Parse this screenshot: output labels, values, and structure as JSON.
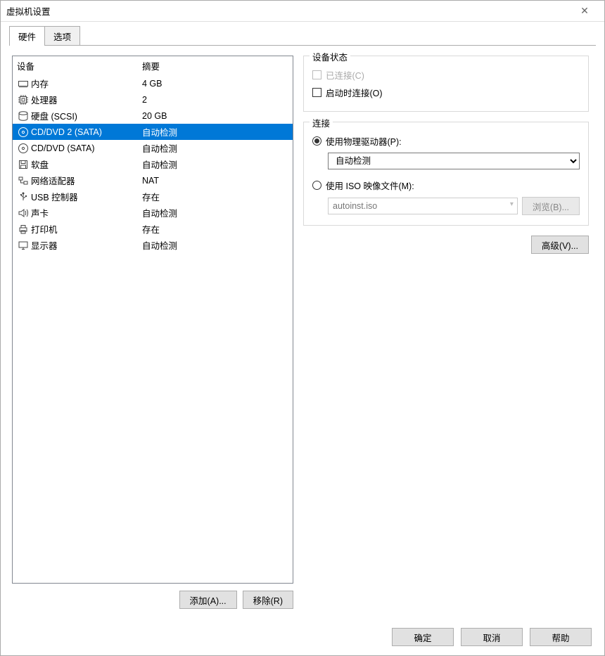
{
  "window": {
    "title": "虚拟机设置"
  },
  "tabs": {
    "hardware": "硬件",
    "options": "选项"
  },
  "columns": {
    "device": "设备",
    "summary": "摘要"
  },
  "devices": [
    {
      "icon": "memory-icon",
      "name": "内存",
      "summary": "4 GB"
    },
    {
      "icon": "cpu-icon",
      "name": "处理器",
      "summary": "2"
    },
    {
      "icon": "disk-icon",
      "name": "硬盘 (SCSI)",
      "summary": "20 GB"
    },
    {
      "icon": "cd-icon",
      "name": "CD/DVD 2 (SATA)",
      "summary": "自动检测",
      "selected": true
    },
    {
      "icon": "cd-icon",
      "name": "CD/DVD (SATA)",
      "summary": "自动检测"
    },
    {
      "icon": "floppy-icon",
      "name": "软盘",
      "summary": "自动检测"
    },
    {
      "icon": "network-icon",
      "name": "网络适配器",
      "summary": "NAT"
    },
    {
      "icon": "usb-icon",
      "name": "USB 控制器",
      "summary": "存在"
    },
    {
      "icon": "sound-icon",
      "name": "声卡",
      "summary": "自动检测"
    },
    {
      "icon": "printer-icon",
      "name": "打印机",
      "summary": "存在"
    },
    {
      "icon": "display-icon",
      "name": "显示器",
      "summary": "自动检测"
    }
  ],
  "buttons": {
    "add": "添加(A)...",
    "remove": "移除(R)",
    "advanced": "高级(V)...",
    "browse": "浏览(B)...",
    "ok": "确定",
    "cancel": "取消",
    "help": "帮助"
  },
  "device_status": {
    "legend": "设备状态",
    "connected": "已连接(C)",
    "connect_at_power_on": "启动时连接(O)"
  },
  "connection": {
    "legend": "连接",
    "use_physical": "使用物理驱动器(P):",
    "physical_value": "自动检测",
    "use_iso": "使用 ISO 映像文件(M):",
    "iso_value": "autoinst.iso"
  }
}
